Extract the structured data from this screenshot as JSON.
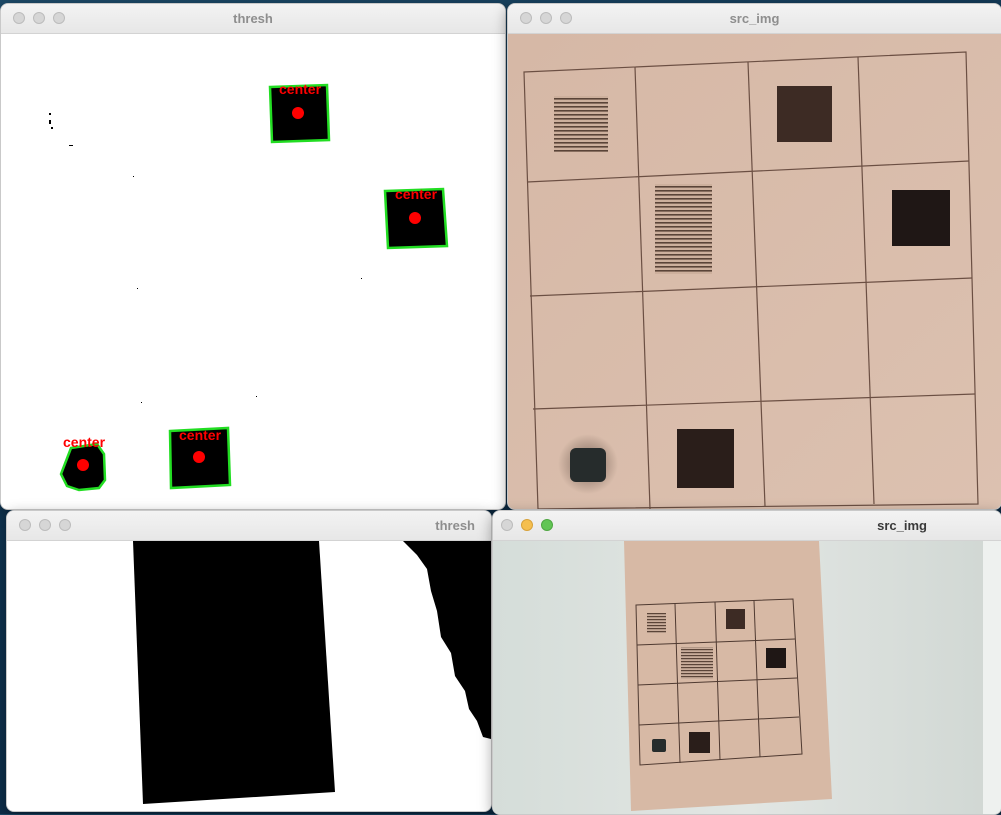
{
  "windows": {
    "thresh_top": {
      "title": "thresh"
    },
    "src_top": {
      "title": "src_img"
    },
    "thresh_bottom": {
      "title": "thresh"
    },
    "src_bottom": {
      "title": "src_img"
    }
  },
  "detections": [
    {
      "label": "center"
    },
    {
      "label": "center"
    },
    {
      "label": "center"
    },
    {
      "label": "center"
    }
  ],
  "colors": {
    "contour": "#22dd22",
    "center_marker": "#ff0000",
    "paper": "#d8b9a7",
    "grid_line": "#6b4f43",
    "traffic_red": "#ed6a5e",
    "traffic_yellow": "#f5bf4f",
    "traffic_green": "#61c554"
  },
  "icons": [
    "close-icon",
    "minimize-icon",
    "zoom-icon"
  ]
}
